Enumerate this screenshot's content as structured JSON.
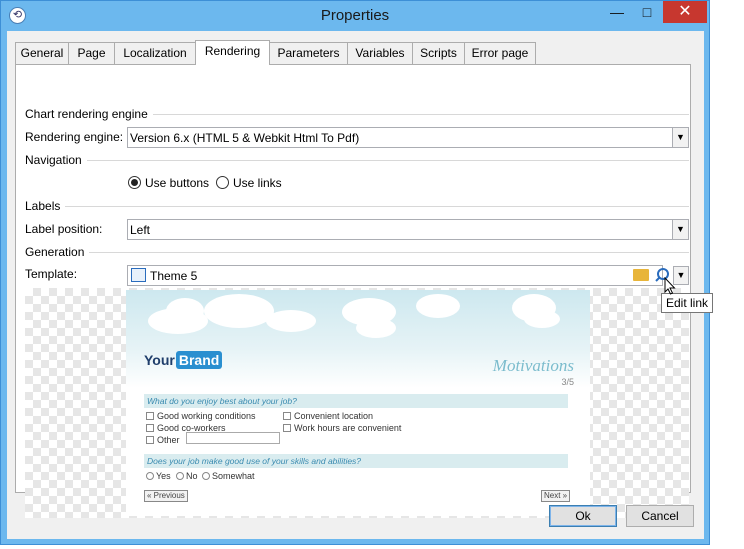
{
  "window": {
    "title": "Properties"
  },
  "tabs": [
    {
      "label": "General"
    },
    {
      "label": "Page"
    },
    {
      "label": "Localization"
    },
    {
      "label": "Rendering"
    },
    {
      "label": "Parameters"
    },
    {
      "label": "Variables"
    },
    {
      "label": "Scripts"
    },
    {
      "label": "Error page"
    }
  ],
  "active_tab": "Rendering",
  "chart_engine": {
    "group_label": "Chart rendering engine",
    "label": "Rendering engine:",
    "value": "Version 6.x (HTML 5 & Webkit Html To Pdf)"
  },
  "navigation": {
    "group_label": "Navigation",
    "options": [
      "Use buttons",
      "Use links"
    ],
    "selected": "Use buttons"
  },
  "labels": {
    "group_label": "Labels",
    "label": "Label position:",
    "value": "Left"
  },
  "generation": {
    "group_label": "Generation",
    "label": "Template:",
    "value": "Theme 5",
    "tooltip": "Edit link"
  },
  "preview": {
    "brand_text": "Your",
    "brand_badge": "Brand",
    "heading": "Motivations",
    "step": "3/5",
    "q1": "What do you enjoy best about your job?",
    "q1_options": [
      "Good working conditions",
      "Convenient location",
      "Good co-workers",
      "Work hours are convenient",
      "Other"
    ],
    "q2": "Does your job make good use of your skills and abilities?",
    "q2_options": [
      "Yes",
      "No",
      "Somewhat"
    ],
    "prev": "« Previous",
    "next": "Next »"
  },
  "buttons": {
    "ok": "Ok",
    "cancel": "Cancel"
  }
}
